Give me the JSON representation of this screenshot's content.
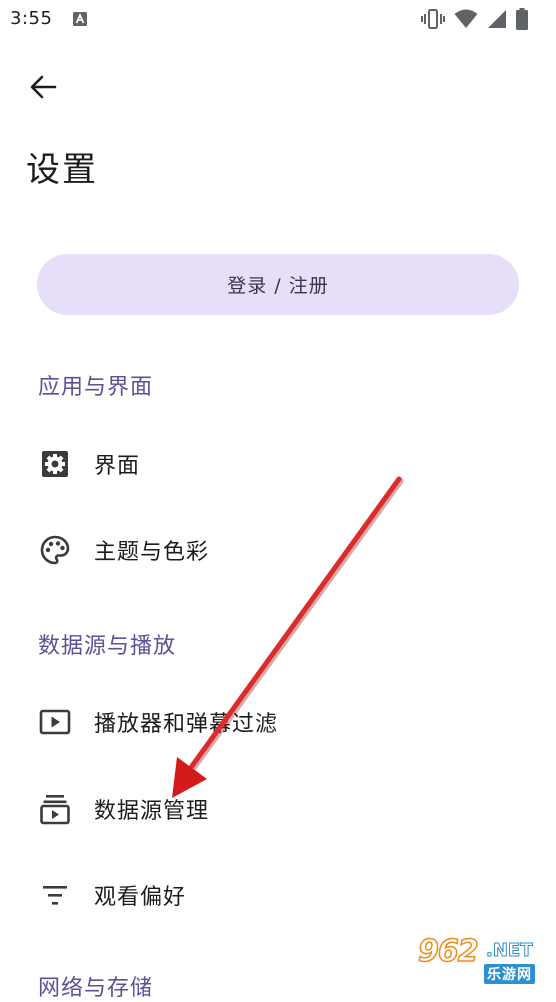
{
  "status_bar": {
    "time": "3:55",
    "icons": [
      "a-notification-icon",
      "vibrate-icon",
      "wifi-icon",
      "signal-icon",
      "battery-icon"
    ]
  },
  "header": {
    "back_icon": "arrow-left-icon",
    "title": "设置"
  },
  "account": {
    "login_label": "登录 / 注册"
  },
  "sections": [
    {
      "header": "应用与界面",
      "items": [
        {
          "label": "界面",
          "icon": "settings-box-icon"
        },
        {
          "label": "主题与色彩",
          "icon": "palette-icon"
        }
      ]
    },
    {
      "header": "数据源与播放",
      "items": [
        {
          "label": "播放器和弹幕过滤",
          "icon": "play-box-icon"
        },
        {
          "label": "数据源管理",
          "icon": "subscriptions-icon"
        },
        {
          "label": "观看偏好",
          "icon": "filter-list-icon"
        }
      ]
    },
    {
      "header": "网络与存储",
      "items": []
    }
  ],
  "watermark": {
    "number": "962",
    "net": ".NET",
    "sub": "乐游网"
  },
  "colors": {
    "accent": "#5e4f99",
    "button_bg": "#e7defa",
    "arrow": "#e01e1e",
    "text": "#1c1b1f"
  }
}
